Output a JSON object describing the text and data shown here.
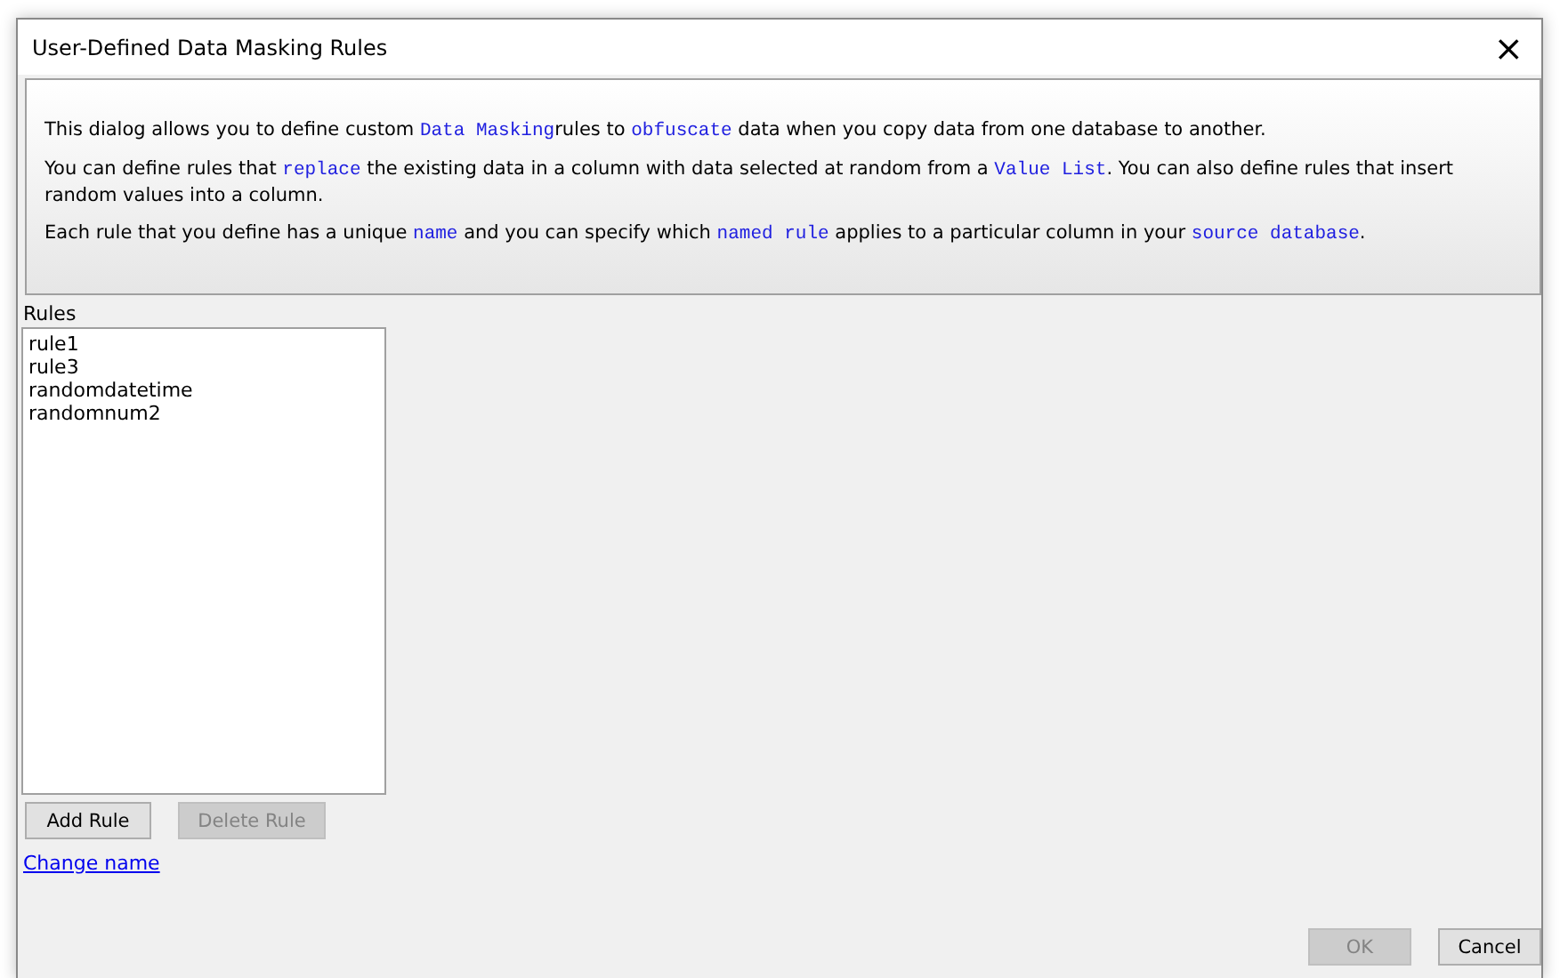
{
  "window": {
    "title": "User-Defined Data Masking Rules",
    "close": "×"
  },
  "intro": [
    [
      {
        "kind": "text",
        "text": "This dialog allows you to define custom "
      },
      {
        "kind": "code",
        "text": "Data Masking"
      },
      {
        "kind": "text",
        "text": "rules to "
      },
      {
        "kind": "code",
        "text": "obfuscate"
      },
      {
        "kind": "text",
        "text": " data when you copy data from one database to another."
      }
    ],
    [
      {
        "kind": "text",
        "text": "You can define rules that "
      },
      {
        "kind": "code",
        "text": "replace"
      },
      {
        "kind": "text",
        "text": " the existing data in a column with data selected at random from a "
      },
      {
        "kind": "code",
        "text": "Value List"
      },
      {
        "kind": "text",
        "text": ". You can also define rules that insert random values into a column."
      }
    ],
    [
      {
        "kind": "text",
        "text": "Each rule that you define has a unique "
      },
      {
        "kind": "code",
        "text": "name"
      },
      {
        "kind": "text",
        "text": " and you can specify which "
      },
      {
        "kind": "code",
        "text": "named rule"
      },
      {
        "kind": "text",
        "text": " applies to a particular column in your "
      },
      {
        "kind": "code",
        "text": "source database"
      },
      {
        "kind": "text",
        "text": "."
      }
    ]
  ],
  "rules": {
    "label": "Rules",
    "items": [
      "rule1",
      "rule3",
      "randomdatetime",
      "randomnum2"
    ]
  },
  "rule_buttons": [
    {
      "label": "Add Rule",
      "disabled": false
    },
    {
      "label": "Delete Rule",
      "disabled": true
    }
  ],
  "link": "Change name",
  "footer_buttons": [
    {
      "label": "OK",
      "disabled": true
    },
    {
      "label": "Cancel",
      "disabled": false
    }
  ]
}
